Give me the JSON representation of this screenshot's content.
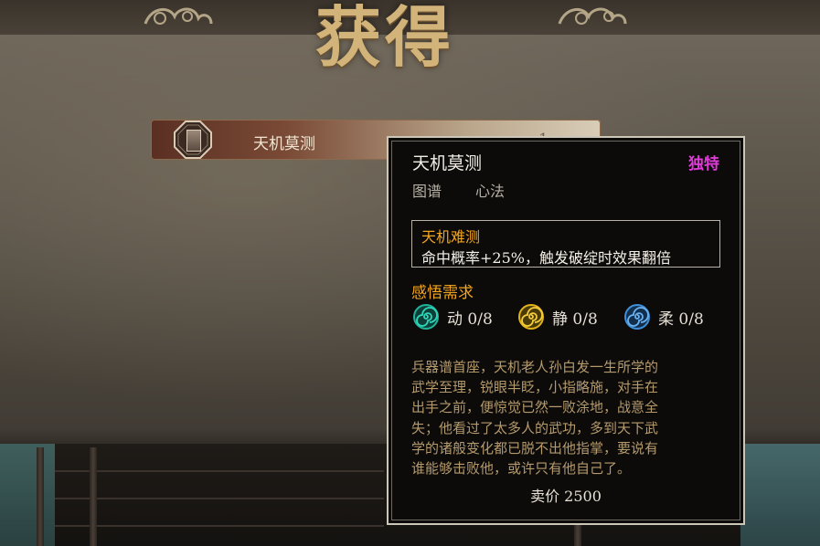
{
  "header": {
    "title": "获得"
  },
  "item": {
    "name": "天机莫测",
    "count": "1"
  },
  "tooltip": {
    "title": "天机莫测",
    "rarity": "独特",
    "rarity_color": "#e03ad8",
    "tags": [
      "图谱",
      "心法"
    ],
    "effect": {
      "name": "天机难测",
      "description": "命中概率+25%，触发破绽时效果翻倍"
    },
    "requirements": {
      "title": "感悟需求",
      "items": [
        {
          "icon": "swirl-green-icon",
          "color": "#1fb39a",
          "label": "动 0/8"
        },
        {
          "icon": "swirl-yellow-icon",
          "color": "#e0b21c",
          "label": "静 0/8"
        },
        {
          "icon": "swirl-blue-icon",
          "color": "#3f8ed8",
          "label": "柔 0/8"
        }
      ]
    },
    "lore": [
      "兵器谱首座，天机老人孙白发一生所学的",
      "武学至理，锐眼半眨，小指略施，对手在",
      "出手之前，便惊觉已然一败涂地，战意全",
      "失；他看过了太多人的武功，多到天下武",
      "学的诸般变化都已脱不出他指掌，要说有",
      "谁能够击败他，或许只有他自己了。"
    ],
    "price": "卖价 2500"
  }
}
